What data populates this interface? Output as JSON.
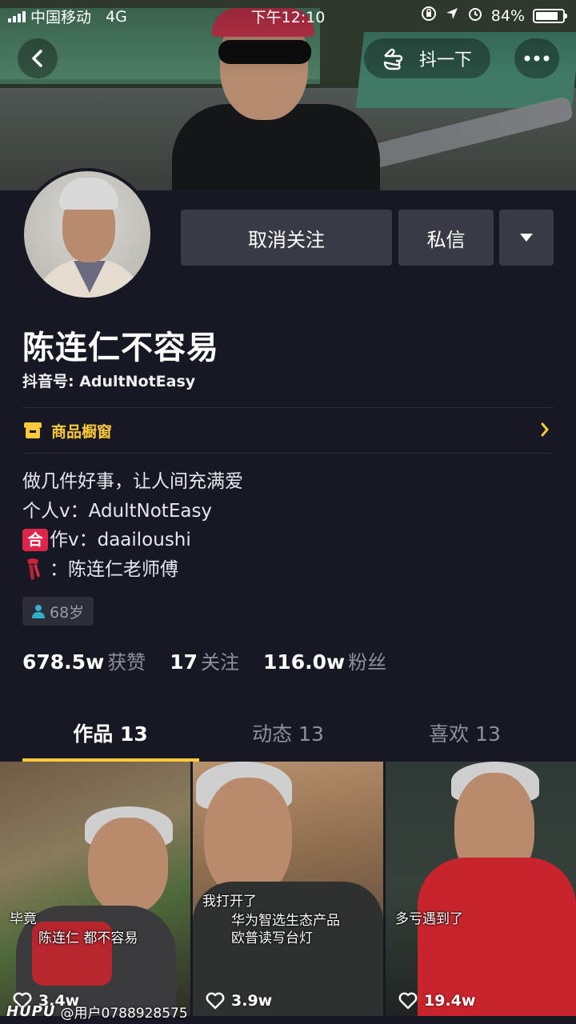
{
  "status_bar": {
    "carrier": "中国移动",
    "network": "4G",
    "time": "下午12:10",
    "battery": "84%",
    "battery_level": 0.84
  },
  "nav": {
    "shake_label": "抖一下"
  },
  "profile": {
    "name": "陈连仁不容易",
    "douyin_id": "抖音号: AdultNotEasy",
    "unfollow_label": "取消关注",
    "message_label": "私信"
  },
  "shop": {
    "label": "商品橱窗"
  },
  "bio": {
    "line1": "做几件好事，让人间充满爱",
    "line2": "个人v：AdultNotEasy",
    "he_glyph": "合",
    "line3": "作v：daailoushi",
    "line4": "：陈连仁老师傅"
  },
  "age": {
    "label": "68岁"
  },
  "stats": {
    "likes_num": "678.5w",
    "likes_label": "获赞",
    "following_num": "17",
    "following_label": "关注",
    "followers_num": "116.0w",
    "followers_label": "粉丝"
  },
  "tabs": [
    {
      "label": "作品 13"
    },
    {
      "label": "动态 13"
    },
    {
      "label": "喜欢 13"
    }
  ],
  "videos": [
    {
      "caption_a": "毕竟",
      "caption_b": "陈连仁  都不容易",
      "likes": "3.4w"
    },
    {
      "caption_a": "我打开了",
      "caption_b": "华为智选生态产品",
      "caption_c": "欧普读写台灯",
      "likes": "3.9w"
    },
    {
      "caption_a": "多亏遇到了",
      "likes": "19.4w"
    }
  ],
  "watermark": {
    "brand": "HUPU",
    "user": "@用户0788928575"
  },
  "colors": {
    "background": "#161823",
    "accent": "#fbc93a",
    "button": "#393b44",
    "muted": "#8f9099",
    "he_badge": "#e0254a"
  }
}
